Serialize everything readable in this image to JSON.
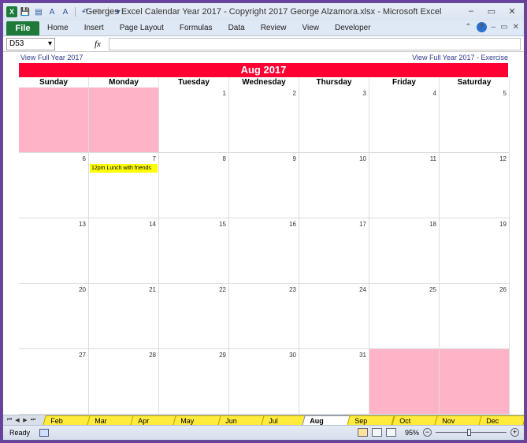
{
  "window": {
    "title": "Georges Excel Calendar Year 2017  -  Copyright 2017 George Alzamora.xlsx  -  Microsoft Excel",
    "controls": [
      "–",
      "▭",
      "✕"
    ]
  },
  "qat": {
    "app_icon": "X",
    "icons": [
      "save-icon",
      "print-icon",
      "find-icon",
      "format-icon",
      "undo-icon",
      "redo-icon",
      "customize-icon"
    ]
  },
  "ribbon": {
    "file": "File",
    "tabs": [
      "Home",
      "Insert",
      "Page Layout",
      "Formulas",
      "Data",
      "Review",
      "View",
      "Developer"
    ],
    "right_icons": [
      "⌃",
      "?",
      "–",
      "▭",
      "✕"
    ]
  },
  "formula_bar": {
    "name_box": "D53",
    "fx": "fx",
    "value": ""
  },
  "calendar": {
    "link_left": "View Full Year 2017",
    "link_right": "View Full Year 2017 - Exercise",
    "month": "Aug 2017",
    "days_of_week": [
      "Sunday",
      "Monday",
      "Tuesday",
      "Wednesday",
      "Thursday",
      "Friday",
      "Saturday"
    ],
    "weeks": [
      [
        "",
        "",
        "1",
        "2",
        "3",
        "4",
        "5"
      ],
      [
        "6",
        "7",
        "8",
        "9",
        "10",
        "11",
        "12"
      ],
      [
        "13",
        "14",
        "15",
        "16",
        "17",
        "18",
        "19"
      ],
      [
        "20",
        "21",
        "22",
        "23",
        "24",
        "25",
        "26"
      ],
      [
        "27",
        "28",
        "29",
        "30",
        "31",
        "",
        ""
      ]
    ],
    "events": {
      "7": "12pm Lunch with friends"
    },
    "blank_color": "#ffb3c6",
    "event_color": "#ffff00",
    "banner_color": "#ff0033"
  },
  "sheet_tabs": {
    "nav": [
      "⏮",
      "◀",
      "▶",
      "⏭"
    ],
    "tabs": [
      "Feb 2017",
      "Mar 2017",
      "Apr 2017",
      "May 2017",
      "Jun 2017",
      "Jul 2017",
      "Aug 2017",
      "Sep 2017",
      "Oct 2017",
      "Nov 2017",
      "Dec 2017"
    ],
    "active": "Aug 2017"
  },
  "status": {
    "ready": "Ready",
    "zoom": "95%",
    "zoom_minus": "−",
    "zoom_plus": "+",
    "zoom_level": 0.95
  }
}
